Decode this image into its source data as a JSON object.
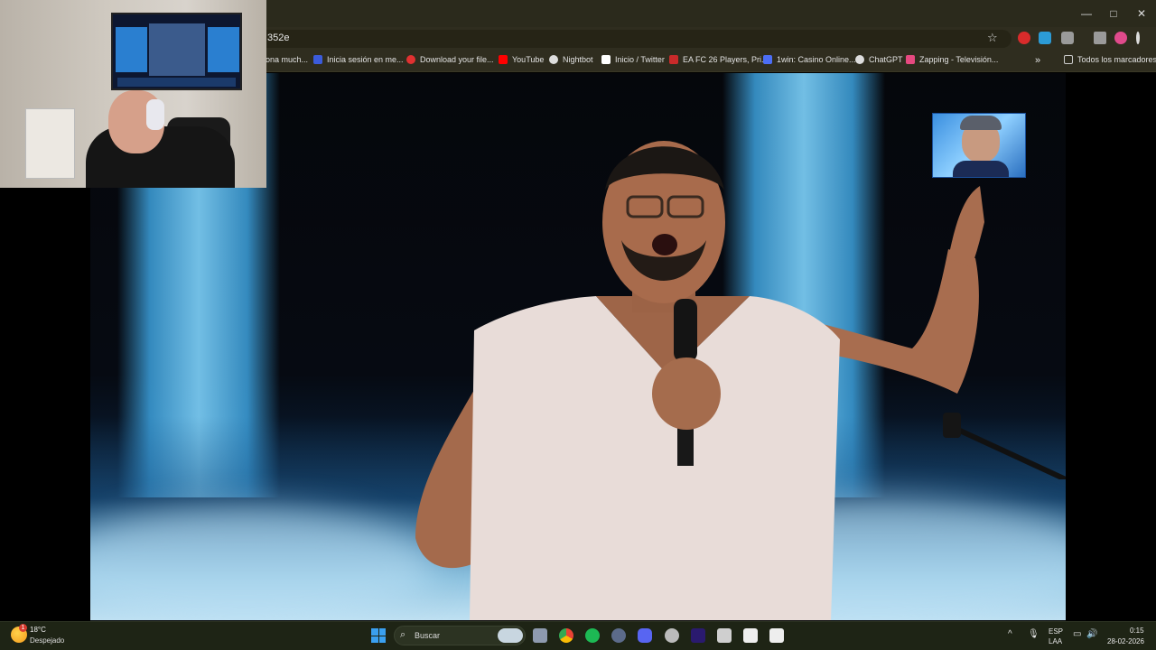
{
  "browser": {
    "url_fragment": "352e",
    "window_controls": [
      "—",
      "□",
      "✕"
    ],
    "extensions_colors": [
      "#d92b2b",
      "#2c9bd6",
      "#cfcfcf",
      "#cfcfcf",
      "#e04a8c"
    ]
  },
  "bookmarks": {
    "items": [
      {
        "label": "ona much...",
        "icon": "bookmark-icon",
        "color": "#cccccc"
      },
      {
        "label": "Inicia sesión en me...",
        "icon": "ea-icon",
        "color": "#3b5bdb"
      },
      {
        "label": "Download your file...",
        "icon": "download-icon",
        "color": "#e03131"
      },
      {
        "label": "YouTube",
        "icon": "youtube-icon",
        "color": "#ff0000"
      },
      {
        "label": "Nightbot",
        "icon": "nightbot-icon",
        "color": "#dddddd"
      },
      {
        "label": "Inicio / Twitter",
        "icon": "x-icon",
        "color": "#ffffff"
      },
      {
        "label": "EA FC 26 Players, Pri...",
        "icon": "futbin-icon",
        "color": "#c92a2a"
      },
      {
        "label": "1win: Casino Online...",
        "icon": "casino-icon",
        "color": "#4c6ef5"
      },
      {
        "label": "ChatGPT",
        "icon": "chatgpt-icon",
        "color": "#dddddd"
      },
      {
        "label": "Zapping - Televisión...",
        "icon": "zapping-icon",
        "color": "#e64980"
      }
    ],
    "more": "»",
    "all_bookmarks": "Todos los marcadores"
  },
  "taskbar": {
    "weather": {
      "temp": "18°C",
      "desc": "Despejado",
      "badge": "1"
    },
    "search_placeholder": "Buscar",
    "apps": [
      {
        "name": "file-explorer-icon",
        "color": "#8e9aaf"
      },
      {
        "name": "chrome-icon",
        "color": "#4caf50"
      },
      {
        "name": "spotify-icon",
        "color": "#1db954"
      },
      {
        "name": "app-icon",
        "color": "#5c6b8a"
      },
      {
        "name": "discord-icon",
        "color": "#5865f2"
      },
      {
        "name": "obs-icon",
        "color": "#bbbbbb"
      },
      {
        "name": "premiere-icon",
        "color": "#2a1a6e"
      },
      {
        "name": "adobe-icon",
        "color": "#cfcfcf"
      },
      {
        "name": "capcut-icon",
        "color": "#eeeeee"
      },
      {
        "name": "capcut-2-icon",
        "color": "#eeeeee"
      }
    ],
    "tray": {
      "chevron": "^",
      "lang": "ESP",
      "layout": "LAA",
      "time": "0:15",
      "date": "28-02-2026"
    }
  }
}
